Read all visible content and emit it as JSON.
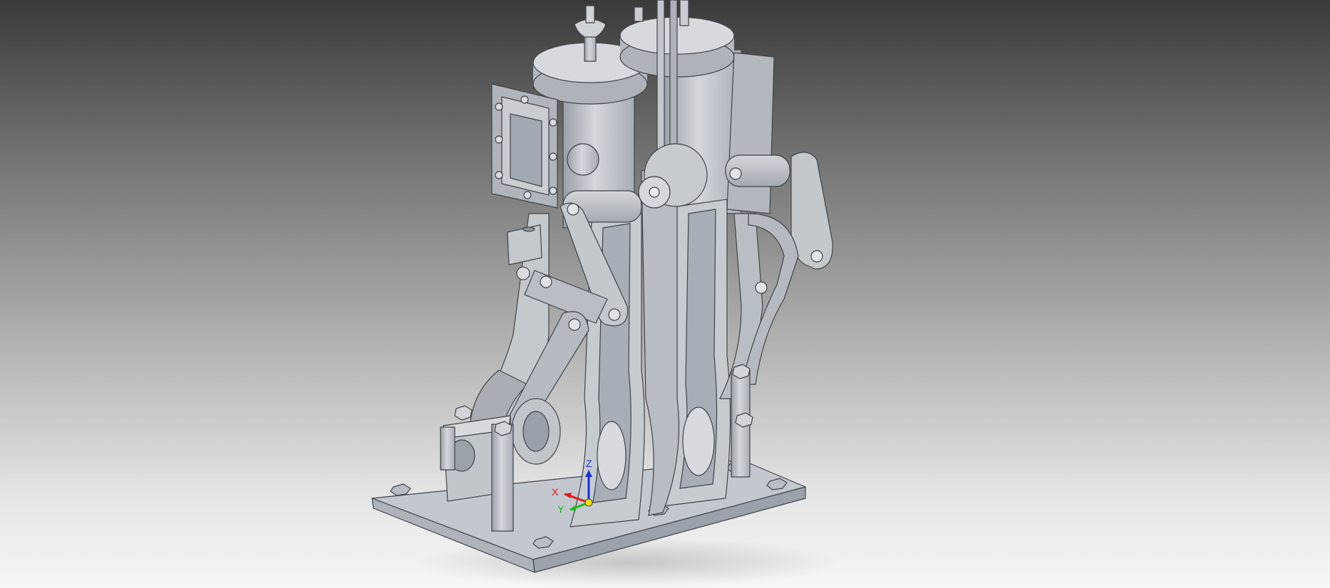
{
  "viewport": {
    "model": "steam-engine-assembly",
    "render_mode": "shaded-with-edges",
    "background": {
      "top": "#3a3a3a",
      "bottom": "#f6f6f6"
    }
  },
  "colors": {
    "part_face": "#b7bcc2",
    "part_light": "#d6dadf",
    "part_dark": "#8d939a",
    "edge": "#3f444a",
    "axis_x": "#e01818",
    "axis_y": "#18b818",
    "axis_z": "#1830e0",
    "origin": "#f2e200"
  },
  "triad": {
    "x_label": "X",
    "y_label": "Y",
    "z_label": "Z"
  }
}
